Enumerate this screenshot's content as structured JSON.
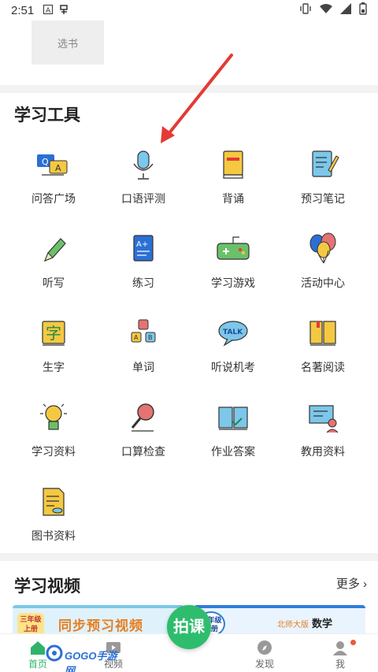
{
  "status_bar": {
    "time": "2:51"
  },
  "top_card": {
    "book_label": "选书"
  },
  "tools": {
    "title": "学习工具",
    "items": [
      {
        "label": "问答广场",
        "icon": "qa-chat-icon"
      },
      {
        "label": "口语评测",
        "icon": "microphone-icon"
      },
      {
        "label": "背诵",
        "icon": "book-icon"
      },
      {
        "label": "预习笔记",
        "icon": "notebook-icon"
      },
      {
        "label": "听写",
        "icon": "pencil-icon"
      },
      {
        "label": "练习",
        "icon": "exercise-paper-icon"
      },
      {
        "label": "学习游戏",
        "icon": "gamepad-icon"
      },
      {
        "label": "活动中心",
        "icon": "balloons-icon"
      },
      {
        "label": "生字",
        "icon": "character-card-icon"
      },
      {
        "label": "单词",
        "icon": "letter-blocks-icon"
      },
      {
        "label": "听说机考",
        "icon": "talk-bubble-icon"
      },
      {
        "label": "名著阅读",
        "icon": "open-book-icon"
      },
      {
        "label": "学习资料",
        "icon": "lightbulb-icon"
      },
      {
        "label": "口算检查",
        "icon": "magnifier-icon"
      },
      {
        "label": "作业答案",
        "icon": "answer-book-icon"
      },
      {
        "label": "教用资料",
        "icon": "teacher-board-icon"
      },
      {
        "label": "图书资料",
        "icon": "document-icon"
      }
    ]
  },
  "video_section": {
    "title": "学习视频",
    "more_label": "更多",
    "banner1": {
      "grade": "三年级上册",
      "text": "同步预习视频"
    },
    "banner2": {
      "grade": "四年级上册",
      "edition": "北师大版",
      "subject": "数学"
    }
  },
  "tab_bar": {
    "home": "首页",
    "video": "视频",
    "center": "拍课",
    "discover": "发现",
    "me": "我"
  },
  "watermark": "GOGO手游网",
  "colors": {
    "accent": "#2ebd6d",
    "arrow": "#e53935",
    "icon_yellow": "#f5c842",
    "icon_blue": "#2b6fd6"
  }
}
